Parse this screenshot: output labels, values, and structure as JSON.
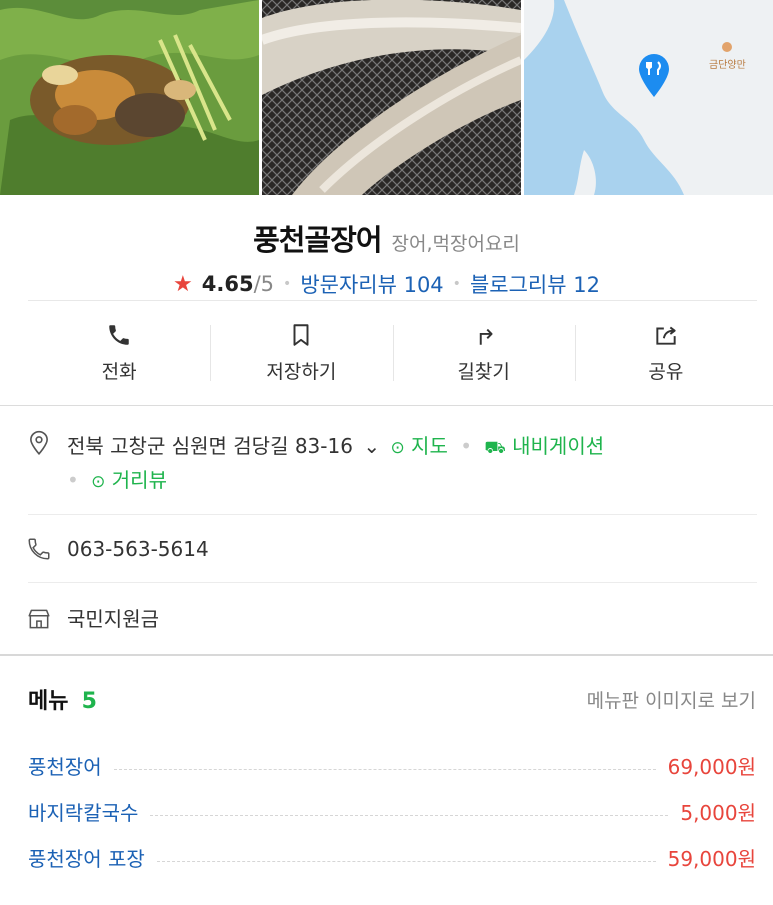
{
  "place": {
    "name": "풍천골장어",
    "category": "장어,먹장어요리",
    "rating": "4.65",
    "rating_max": "/5",
    "visitor_reviews": "방문자리뷰 104",
    "blog_reviews": "블로그리뷰 12"
  },
  "map": {
    "poi_label": "금단양만"
  },
  "actions": [
    {
      "label": "전화",
      "icon": "phone-icon"
    },
    {
      "label": "저장하기",
      "icon": "bookmark-icon"
    },
    {
      "label": "길찾기",
      "icon": "directions-icon"
    },
    {
      "label": "공유",
      "icon": "share-icon"
    }
  ],
  "info": {
    "address": "전북 고창군 심원면 검당길 83-16",
    "map_link": "지도",
    "navigation_link": "내비게이션",
    "streetview_link": "거리뷰",
    "phone": "063-563-5614",
    "support": "국민지원금"
  },
  "menu": {
    "title": "메뉴",
    "count": "5",
    "view_images": "메뉴판 이미지로 보기",
    "items": [
      {
        "name": "풍천장어",
        "price": "69,000원"
      },
      {
        "name": "바지락칼국수",
        "price": "5,000원"
      },
      {
        "name": "풍천장어 포장",
        "price": "59,000원"
      }
    ]
  },
  "colors": {
    "link": "#1c62b5",
    "green": "#1fb44d",
    "price": "#e8453c",
    "star": "#e8453c",
    "map_pin": "#1c8cf0"
  }
}
